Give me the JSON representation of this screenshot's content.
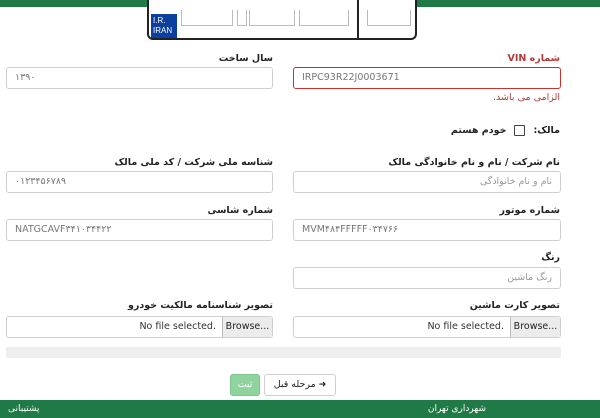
{
  "plate": {
    "country_text_1": "I.R.",
    "country_text_2": "IRAN"
  },
  "form": {
    "vin": {
      "label": "شماره VIN",
      "value": "IRPC93R22J0003671",
      "error": "الزامی می باشد."
    },
    "build_year": {
      "label": "سال ساخت",
      "value": "۱۳۹۰"
    },
    "owner": {
      "label": "مالک:",
      "option_label": "خودم هستم",
      "checked": false
    },
    "owner_name": {
      "label": "نام شرکت / نام و نام خانوادگی مالک",
      "placeholder": "نام و نام خانوادگی"
    },
    "national_id": {
      "label": "شناسه ملی شرکت / کد ملی مالک",
      "value": "۰۱۲۳۴۵۶۷۸۹"
    },
    "engine_no": {
      "label": "شماره موتور",
      "value": "MVM۴۸۴FFFFF۰۳۴۷۶۶"
    },
    "chassis_no": {
      "label": "شماره شاسی",
      "value": "NATGCAVF۳۴۱۰۳۴۴۲۲"
    },
    "color": {
      "label": "رنگ",
      "placeholder": "رنگ ماشین"
    },
    "card_image": {
      "label": "تصویر کارت ماشین",
      "status": "No file selected.",
      "button": "Browse..."
    },
    "ownership_image": {
      "label": "تصویر شناسنامه مالکیت خودرو",
      "status": "No file selected.",
      "button": "Browse..."
    }
  },
  "actions": {
    "submit": "ثبت",
    "prev": "مرحله قبل",
    "prev_icon": "arrow-right-icon"
  },
  "footer": {
    "right_text": "شهرداری تهران",
    "left_text": "پشتیبانی"
  },
  "colors": {
    "brand_green": "#1f7a47",
    "error_red": "#c9302c",
    "submit_green": "#8fd39f"
  }
}
